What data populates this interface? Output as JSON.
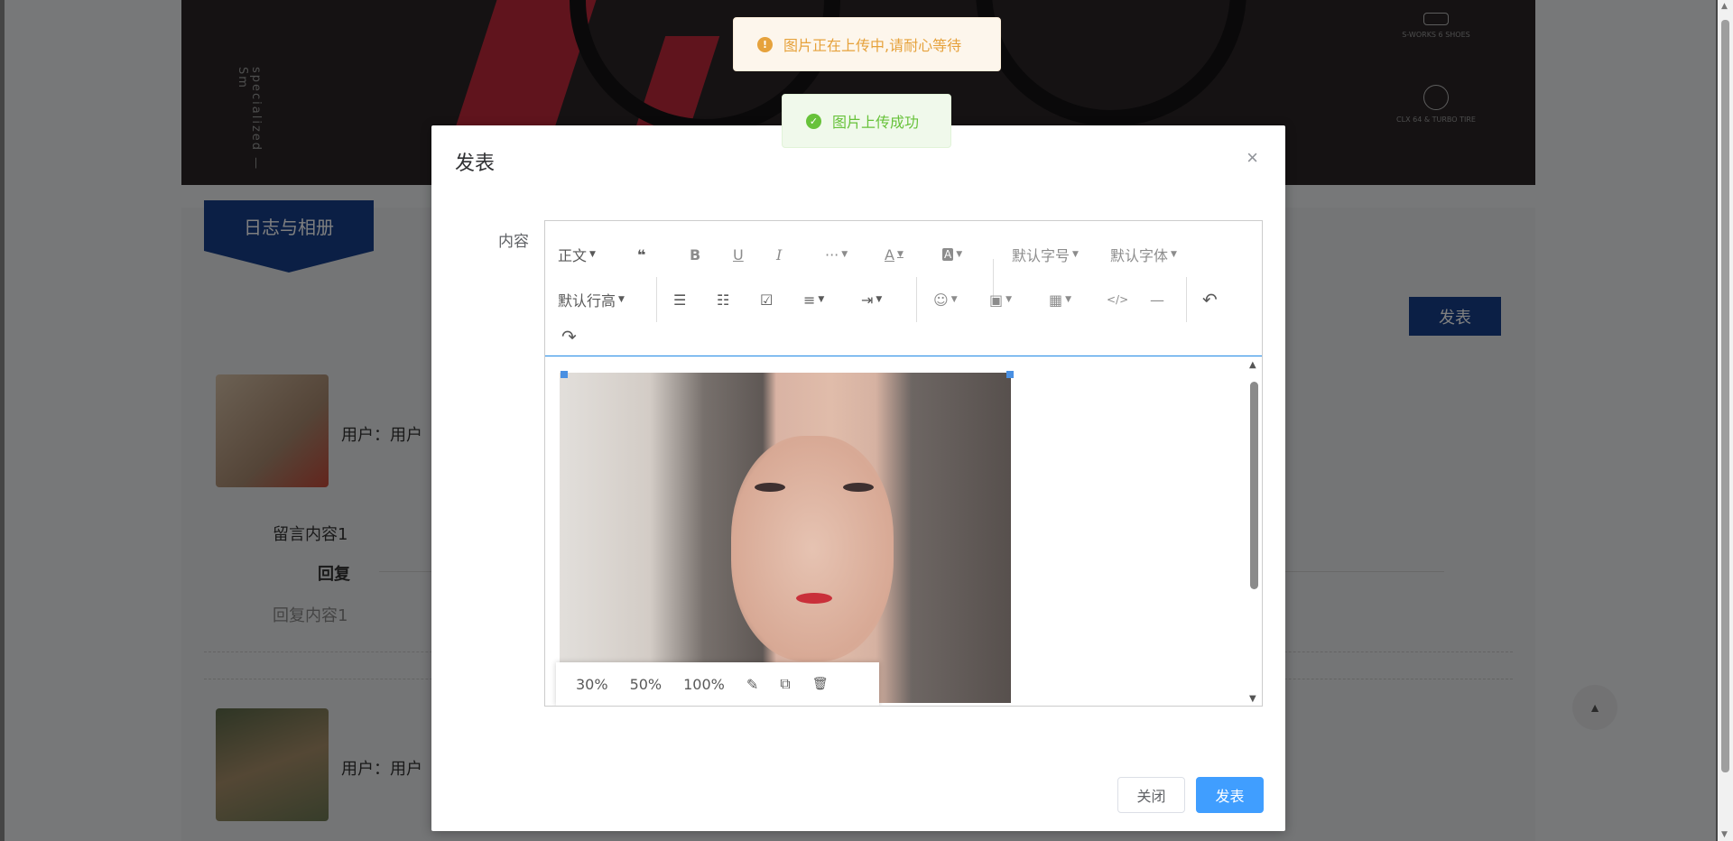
{
  "banner": {
    "vertical_text": "specialized — Sm",
    "side_items": [
      "S-WORKS 6 SHOES",
      "CLX 64 & TURBO TIRE"
    ]
  },
  "section": {
    "tag": "日志与相册"
  },
  "background_page": {
    "publish_button": "发表",
    "posts": [
      {
        "user_label": "用户：用户",
        "content": "留言内容1",
        "reply_heading": "回复",
        "reply_content": "回复内容1"
      },
      {
        "user_label": "用户：用户"
      }
    ],
    "back_to_top": "▲"
  },
  "toasts": {
    "warning": {
      "icon": "!",
      "text": "图片正在上传中,请耐心等待",
      "color": "#e6a23c"
    },
    "success": {
      "icon": "✓",
      "text": "图片上传成功",
      "color": "#67c23a"
    }
  },
  "dialog": {
    "title": "发表",
    "close_icon": "×",
    "field_label": "内容",
    "toolbar": {
      "paragraph": "正文",
      "quote": "❝",
      "bold": "B",
      "underline": "U",
      "italic": "I",
      "more": "···",
      "font_color": "A",
      "bg_color": "A",
      "font_size": "默认字号",
      "font_family": "默认字体",
      "line_height": "默认行高",
      "bullet_list": "☰",
      "numbered_list": "☷",
      "todo": "☑",
      "align": "≡",
      "indent": "⇥",
      "emotion": "☺",
      "image": "▣",
      "table": "▦",
      "code": "</>",
      "divider": "—",
      "undo": "↶",
      "redo": "↷"
    },
    "image_menu": [
      "30%",
      "50%",
      "100%"
    ],
    "image_menu_icons": {
      "edit": "✎",
      "open": "⧉",
      "delete": "🗑"
    },
    "footer": {
      "close": "关闭",
      "publish": "发表"
    },
    "primary_color": "#409eff"
  }
}
